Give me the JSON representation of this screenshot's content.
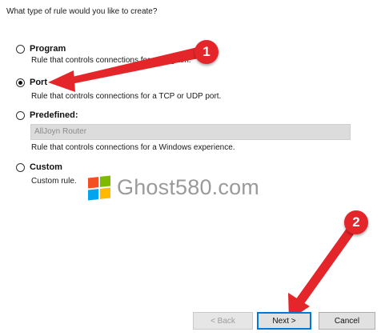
{
  "question": "What type of rule would you like to create?",
  "options": [
    {
      "label": "Program",
      "description": "Rule that controls connections for a program.",
      "selected": false
    },
    {
      "label": "Port",
      "description": "Rule that controls connections for a TCP or UDP port.",
      "selected": true
    },
    {
      "label": "Predefined:",
      "description": "Rule that controls connections for a Windows experience.",
      "selected": false
    },
    {
      "label": "Custom",
      "description": "Custom rule.",
      "selected": false
    }
  ],
  "predefined_select": {
    "value": "AllJoyn Router"
  },
  "watermark": {
    "text": "Ghost580.com"
  },
  "buttons": {
    "back": "< Back",
    "next": "Next >",
    "cancel": "Cancel"
  },
  "annotations": {
    "badge1": "1",
    "badge2": "2",
    "color": "#e4262b"
  },
  "colors": {
    "logo_red": "#f25022",
    "logo_green": "#7fba00",
    "logo_blue": "#00a4ef",
    "logo_yellow": "#ffb900"
  }
}
